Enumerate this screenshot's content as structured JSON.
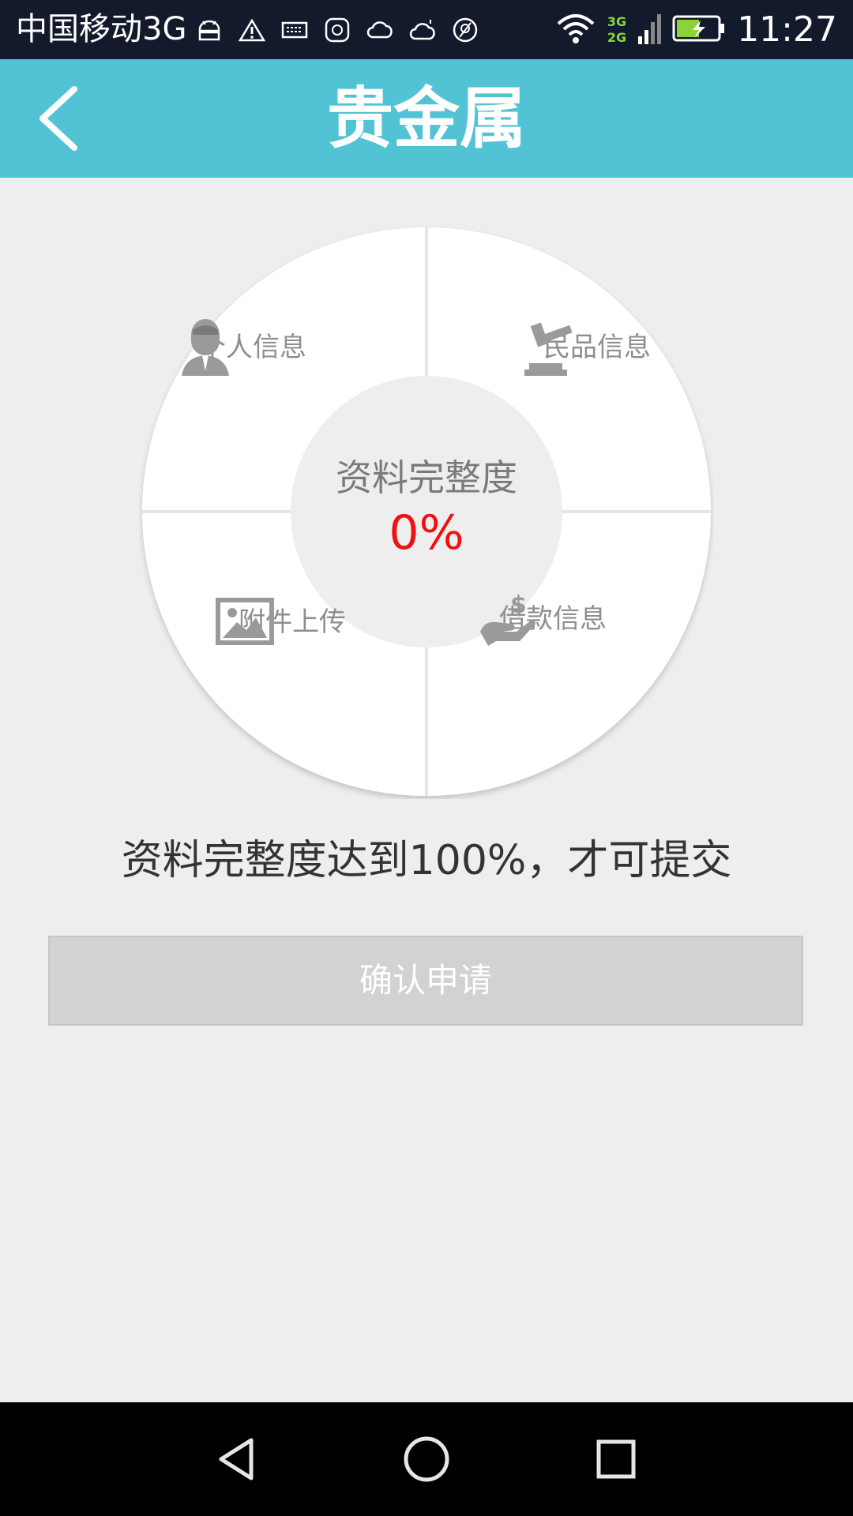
{
  "status_bar": {
    "carrier": "中国移动3G",
    "net_top": "3G",
    "net_bottom": "2G",
    "time": "11:27",
    "icons": [
      "android-icon",
      "warning-icon",
      "keyboard-icon",
      "huawei-icon",
      "cloud-icon",
      "weather-icon",
      "app-icon",
      "wifi-icon",
      "signal-icon",
      "battery-charging-icon"
    ]
  },
  "header": {
    "title": "贵金属",
    "back_icon": "chevron-left-icon"
  },
  "wheel": {
    "center_label": "资料完整度",
    "completion": "0%",
    "sections": [
      {
        "label": "个人信息",
        "icon": "person-icon"
      },
      {
        "label": "民品信息",
        "icon": "gavel-icon"
      },
      {
        "label": "附件上传",
        "icon": "image-icon"
      },
      {
        "label": "借款信息",
        "icon": "money-hand-icon"
      }
    ]
  },
  "notice": "资料完整度达到100%，才可提交",
  "confirm_button": "确认申请",
  "colors": {
    "header": "#52c3d4",
    "status_bar": "#121a2c",
    "percent": "#ee1111",
    "disabled_button": "#d2d2d2",
    "background": "#eeeeee"
  },
  "nav_bar": {
    "icons": [
      "back-triangle-icon",
      "home-circle-icon",
      "recent-square-icon"
    ]
  }
}
